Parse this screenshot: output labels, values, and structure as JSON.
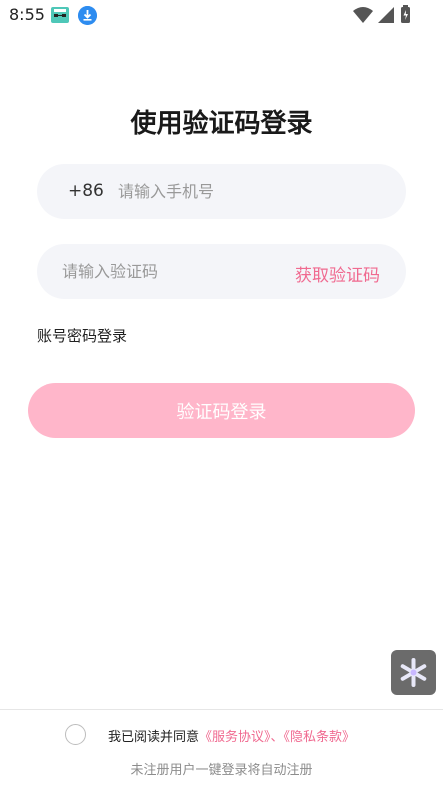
{
  "status_bar": {
    "time": "8:55",
    "icons": [
      "app-notification-icon",
      "download-icon",
      "wifi-icon",
      "signal-icon",
      "battery-icon"
    ]
  },
  "title": "使用验证码登录",
  "phone": {
    "country_code": "+86",
    "placeholder": "请输入手机号"
  },
  "code": {
    "placeholder": "请输入验证码",
    "get_code_label": "获取验证码"
  },
  "switch_login_label": "账号密码登录",
  "login_button_label": "验证码登录",
  "agreement": {
    "prefix": "我已阅读并同意",
    "service_link": "《服务协议》",
    "separator": "、",
    "privacy_link": "《隐私条款》"
  },
  "footer_note": "未注册用户一键登录将自动注册",
  "colors": {
    "accent": "#f06a90",
    "button_bg": "#ffb6ca",
    "field_bg": "#f4f5f9"
  }
}
